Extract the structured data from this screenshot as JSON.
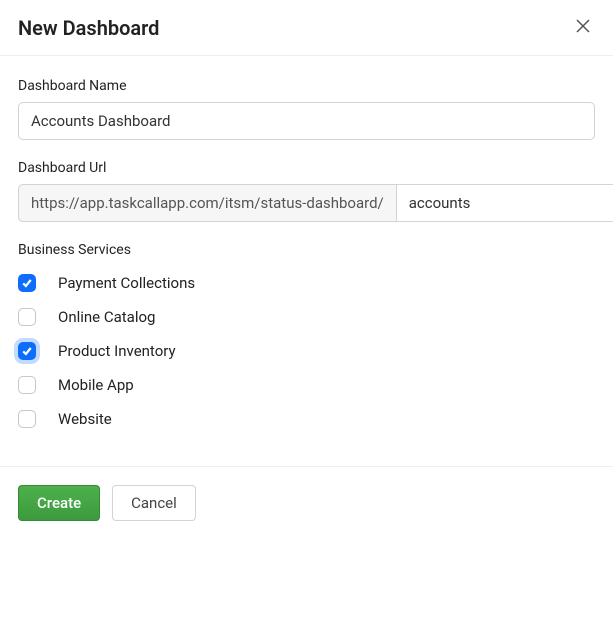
{
  "header": {
    "title": "New Dashboard"
  },
  "form": {
    "name": {
      "label": "Dashboard Name",
      "value": "Accounts Dashboard"
    },
    "url": {
      "label": "Dashboard Url",
      "prefix": "https://app.taskcallapp.com/itsm/status-dashboard/",
      "value": "accounts"
    },
    "services": {
      "label": "Business Services",
      "items": [
        {
          "label": "Payment Collections",
          "checked": true,
          "focused": false
        },
        {
          "label": "Online Catalog",
          "checked": false,
          "focused": false
        },
        {
          "label": "Product Inventory",
          "checked": true,
          "focused": true
        },
        {
          "label": "Mobile App",
          "checked": false,
          "focused": false
        },
        {
          "label": "Website",
          "checked": false,
          "focused": false
        }
      ]
    }
  },
  "footer": {
    "create_label": "Create",
    "cancel_label": "Cancel"
  }
}
